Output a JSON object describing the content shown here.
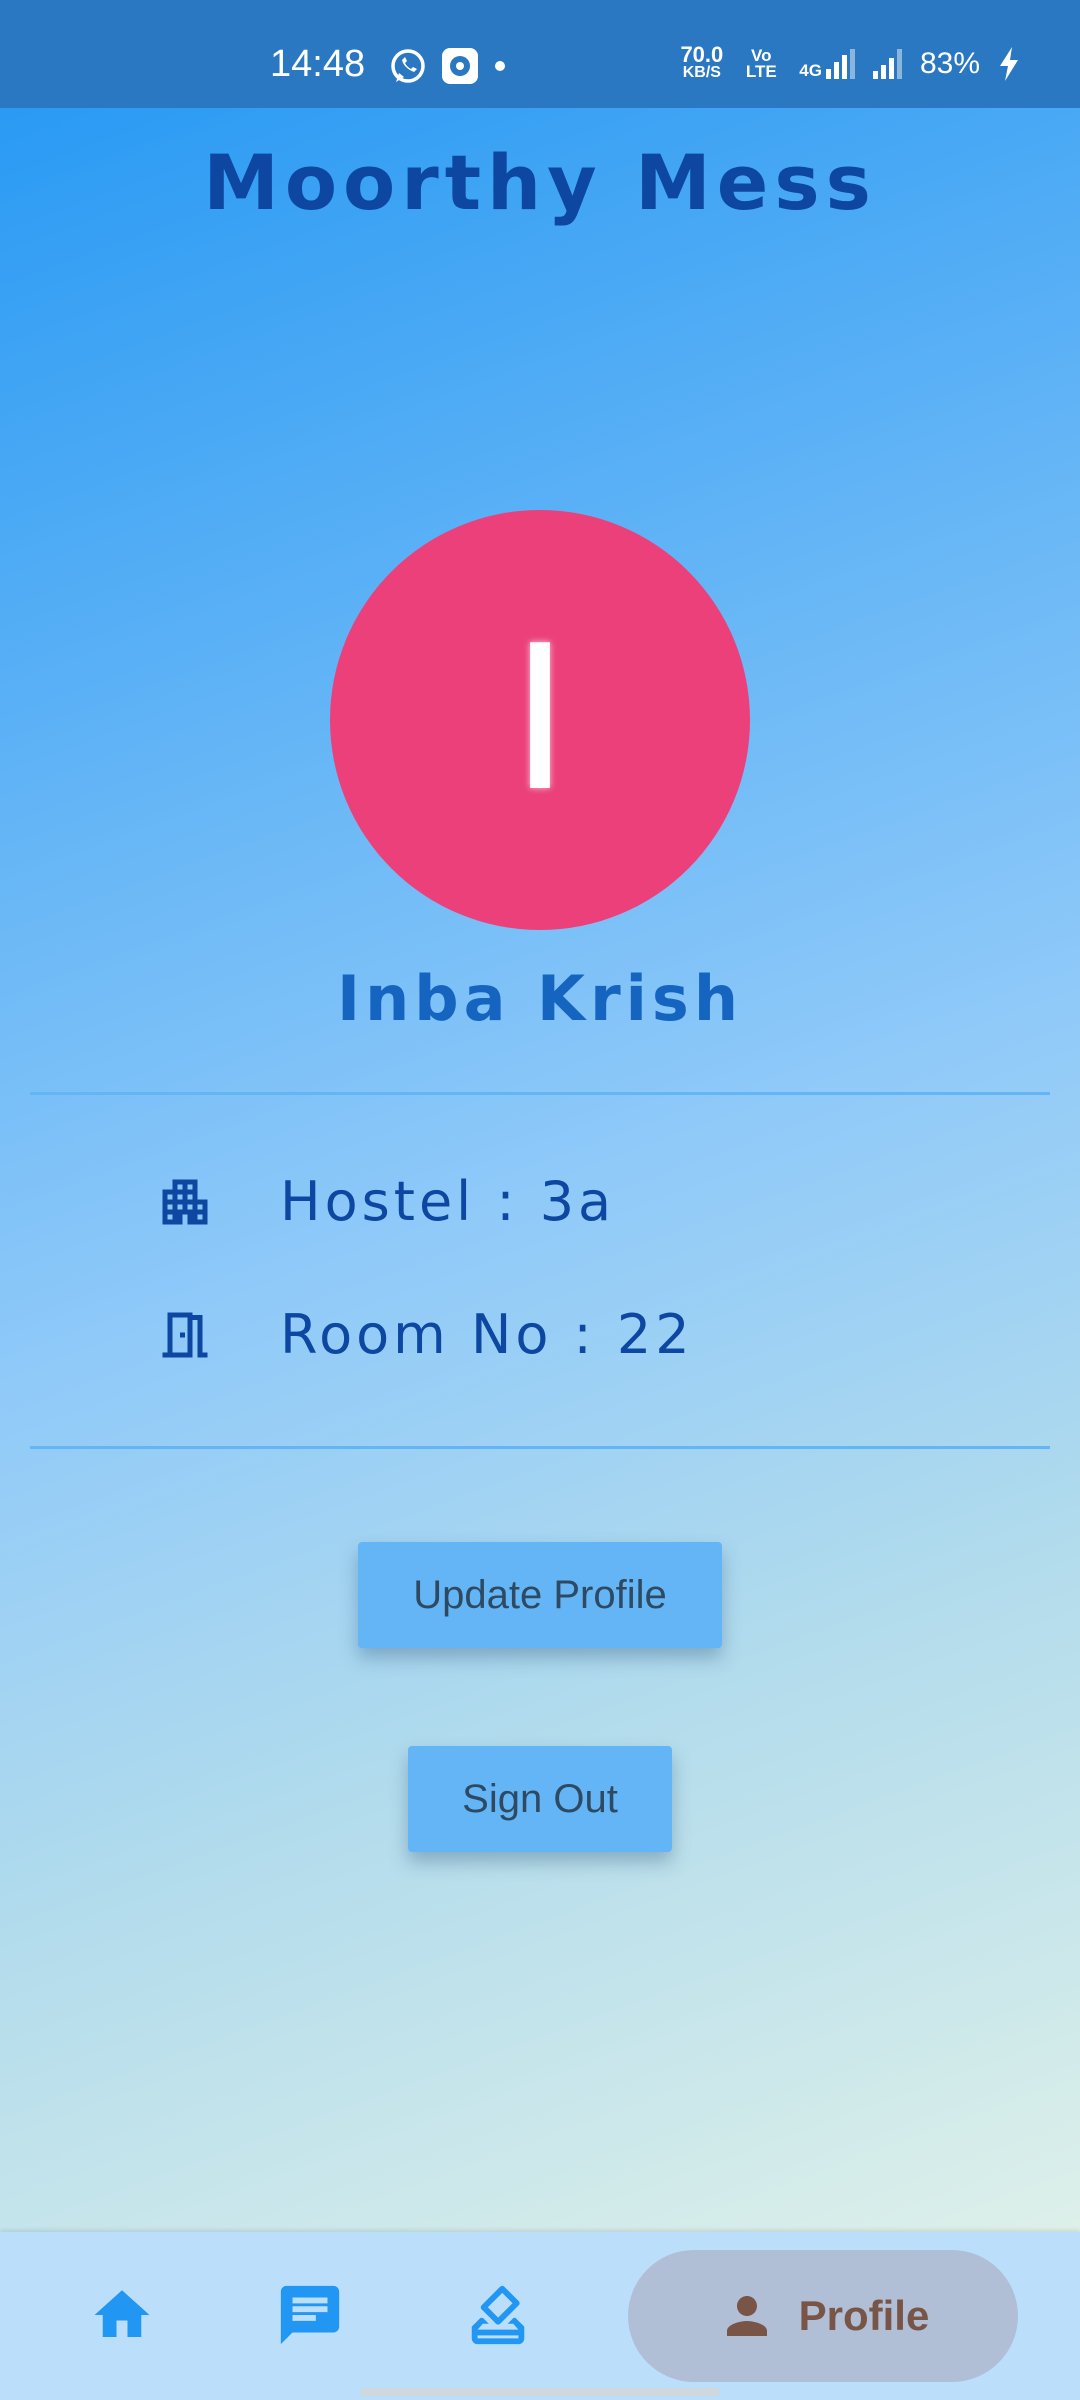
{
  "status_bar": {
    "time": "14:48",
    "net_speed_value": "70.0",
    "net_speed_unit": "KB/S",
    "volte_label": "Vo LTE",
    "network_label": "4G",
    "battery": "83%"
  },
  "header": {
    "title": "Moorthy Mess"
  },
  "profile": {
    "avatar_letter": "I",
    "avatar_color": "#ec407a",
    "name": "Inba Krish"
  },
  "info": {
    "hostel": "Hostel : 3a",
    "room": "Room No : 22"
  },
  "buttons": {
    "update_profile": "Update Profile",
    "sign_out": "Sign Out"
  },
  "bottom_nav": {
    "items": [
      {
        "icon": "home-icon"
      },
      {
        "icon": "message-icon"
      },
      {
        "icon": "vote-icon"
      },
      {
        "icon": "person-icon",
        "label": "Profile",
        "active": true
      }
    ]
  },
  "colors": {
    "accent": "#0d47a1",
    "button": "#64b5f6",
    "nav_active_label": "#795548"
  }
}
